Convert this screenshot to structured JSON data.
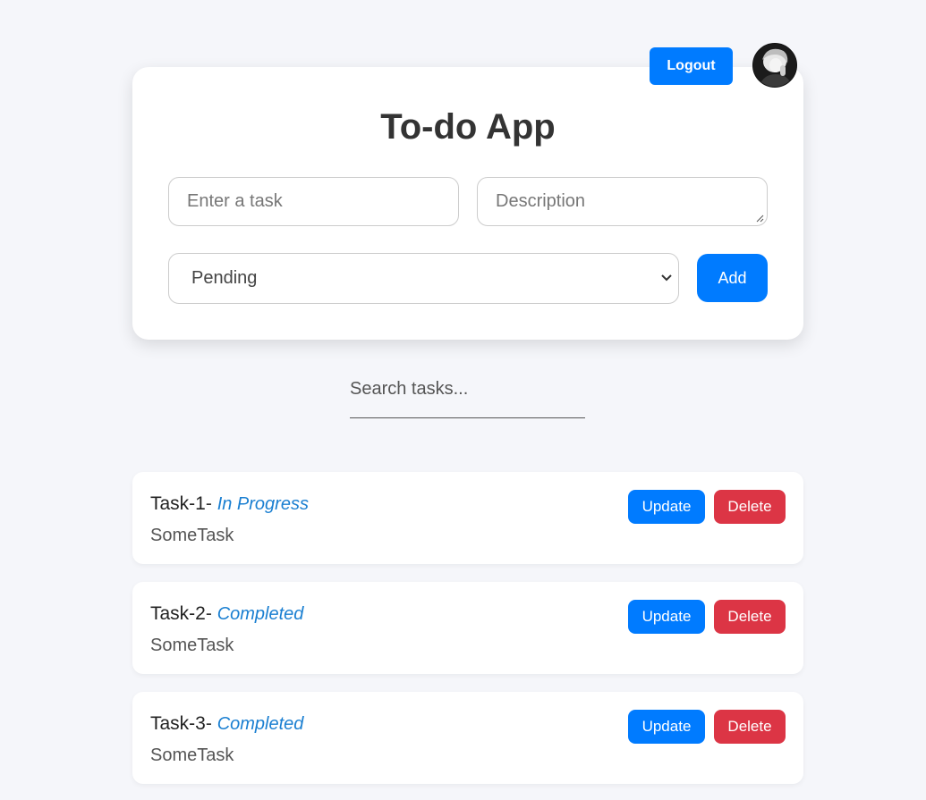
{
  "header": {
    "logout_label": "Logout"
  },
  "app": {
    "title": "To-do App"
  },
  "form": {
    "task_placeholder": "Enter a task",
    "description_placeholder": "Description",
    "status_selected": "Pending",
    "add_label": "Add"
  },
  "search": {
    "placeholder": "Search tasks..."
  },
  "tasks": [
    {
      "name": "Task-1",
      "separator": "- ",
      "status": "In Progress",
      "description": "SomeTask",
      "update_label": "Update",
      "delete_label": "Delete"
    },
    {
      "name": "Task-2",
      "separator": "- ",
      "status": "Completed",
      "description": "SomeTask",
      "update_label": "Update",
      "delete_label": "Delete"
    },
    {
      "name": "Task-3",
      "separator": "- ",
      "status": "Completed",
      "description": "SomeTask",
      "update_label": "Update",
      "delete_label": "Delete"
    }
  ],
  "colors": {
    "primary": "#007bff",
    "danger": "#dc3545",
    "status_text": "#1a7fd1",
    "background": "#f5f6fa"
  }
}
